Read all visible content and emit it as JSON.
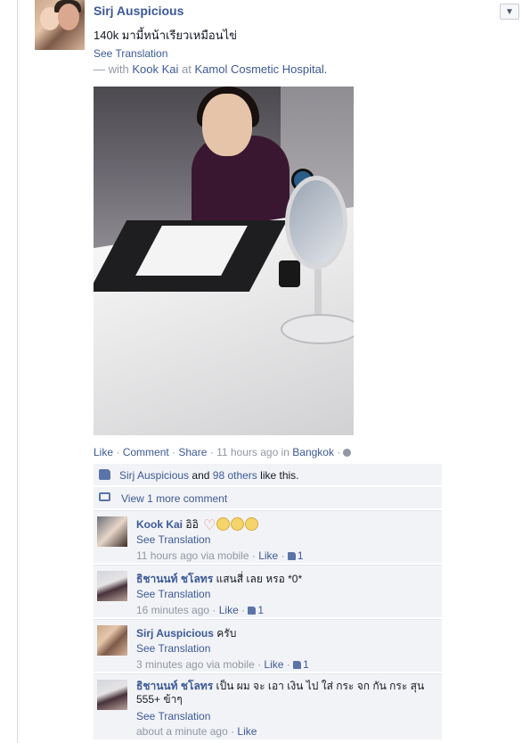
{
  "post": {
    "author": "Sirj Auspicious",
    "status": "140k มามี้หน้าเรียวเหมือนไข่",
    "see_translation": "See Translation",
    "with_prefix": "— with",
    "with_person": "Kook Kai",
    "at_word": "at",
    "place": "Kamol Cosmetic Hospital.",
    "actions": {
      "like": "Like",
      "comment": "Comment",
      "share": "Share",
      "time": "11 hours ago",
      "in_word": "in",
      "location": "Bangkok"
    }
  },
  "likes": {
    "liker": "Sirj Auspicious",
    "and_word": "and",
    "others": "98 others",
    "tail": "like this."
  },
  "view_more": "View 1 more comment",
  "comments": [
    {
      "author": "Kook Kai",
      "text": "อิอิ",
      "see_translation": "See Translation",
      "time": "11 hours ago via mobile",
      "like": "Like",
      "likes_count": "1"
    },
    {
      "author": "ธิชานนท์ ชโลทร",
      "text": "แสนสี่ เลย หรอ *0*",
      "see_translation": "See Translation",
      "time": "16 minutes ago",
      "like": "Like",
      "likes_count": "1"
    },
    {
      "author": "Sirj Auspicious",
      "text": "ครับ",
      "see_translation": "See Translation",
      "time": "3 minutes ago via mobile",
      "like": "Like",
      "likes_count": "1"
    },
    {
      "author": "ธิชานนท์ ชโลทร",
      "text": "เป็น ผม จะ เอา เงิน ไป ใส่ กระ จก กัน กระ สุน 555+ ข้าๆ",
      "see_translation": "See Translation",
      "time": "about a minute ago",
      "like": "Like"
    }
  ],
  "icons": {
    "menu": "chevron-down-icon",
    "globe": "globe-icon",
    "like": "thumbs-up-icon",
    "comment": "comment-icon"
  }
}
